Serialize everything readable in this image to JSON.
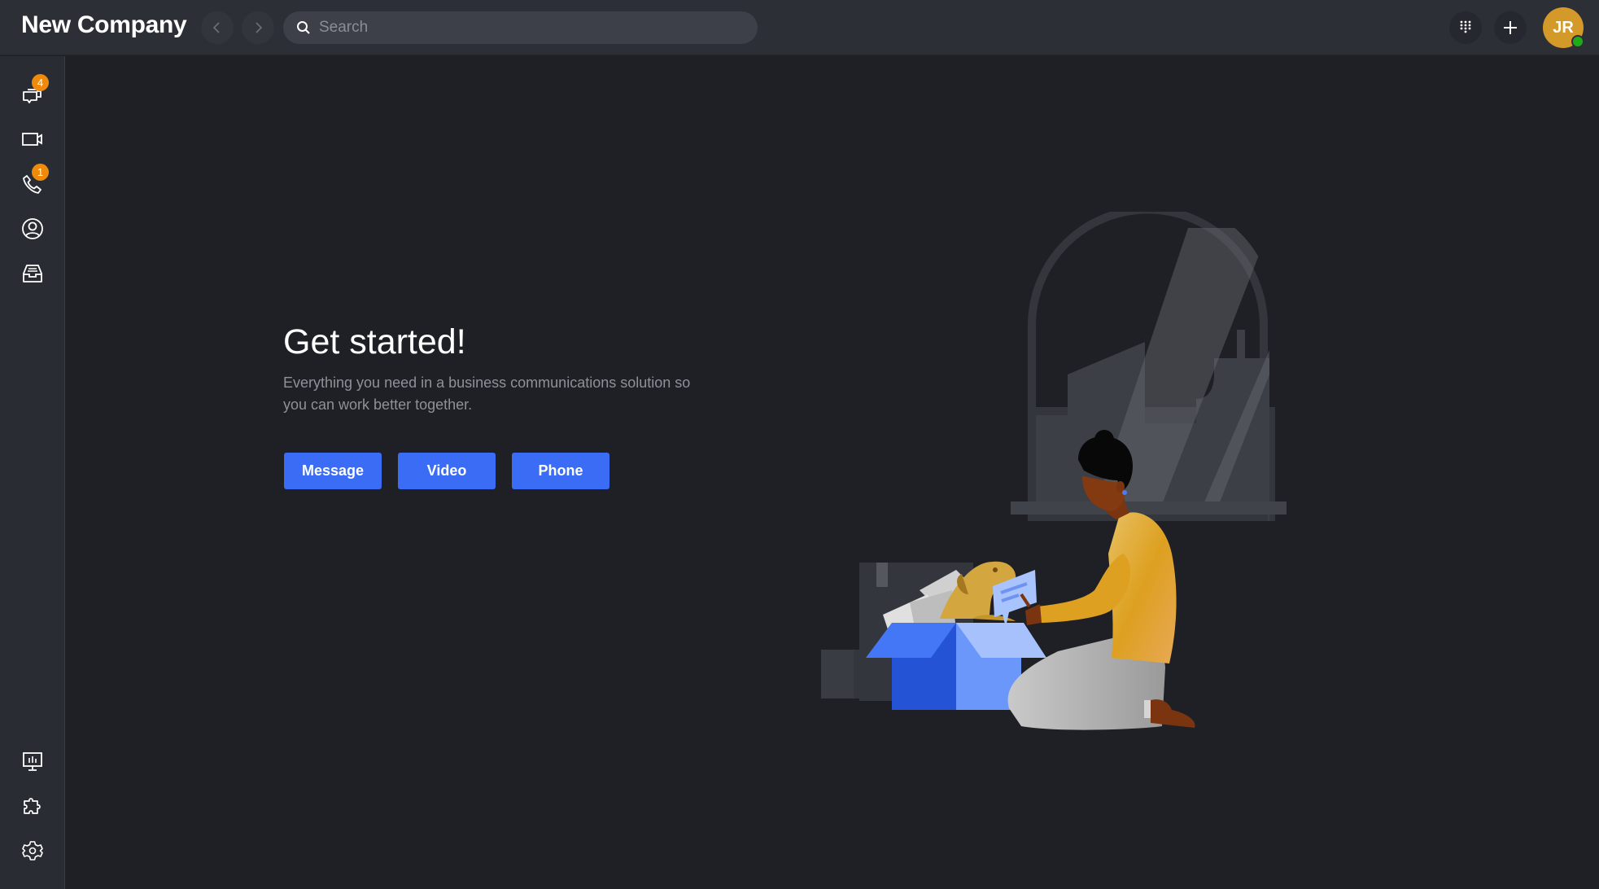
{
  "header": {
    "company_name": "New Company",
    "search_placeholder": "Search",
    "search_value": "",
    "avatar_initials": "JR",
    "presence_status": "online",
    "icons": [
      "chevron-left-icon",
      "chevron-right-icon",
      "search-icon",
      "dialpad-icon",
      "plus-icon"
    ]
  },
  "sidebar": {
    "top_items": [
      {
        "name": "messages",
        "icon": "chat-bubbles-icon",
        "badge": "4"
      },
      {
        "name": "video",
        "icon": "video-camera-icon",
        "badge": ""
      },
      {
        "name": "phone",
        "icon": "phone-icon",
        "badge": "1"
      },
      {
        "name": "contacts",
        "icon": "user-circle-icon",
        "badge": ""
      },
      {
        "name": "inbox",
        "icon": "inbox-tray-icon",
        "badge": ""
      }
    ],
    "bottom_items": [
      {
        "name": "analytics",
        "icon": "monitor-chart-icon"
      },
      {
        "name": "integrations",
        "icon": "puzzle-icon"
      },
      {
        "name": "settings",
        "icon": "gear-icon"
      }
    ]
  },
  "main": {
    "title": "Get started!",
    "subtitle": "Everything you need in a business communications solution so you can work better together.",
    "buttons": [
      {
        "label": "Message"
      },
      {
        "label": "Video"
      },
      {
        "label": "Phone"
      }
    ],
    "illustration": "woman-with-dog-in-box-illustration"
  },
  "colors": {
    "accent": "#3b6cf6",
    "badge": "#f08a0c",
    "avatar": "#d39a2a",
    "presence": "#22a91b",
    "header_bg": "#2d2f37",
    "sidebar_bg": "#2a2c33",
    "main_bg": "#1f2025"
  }
}
